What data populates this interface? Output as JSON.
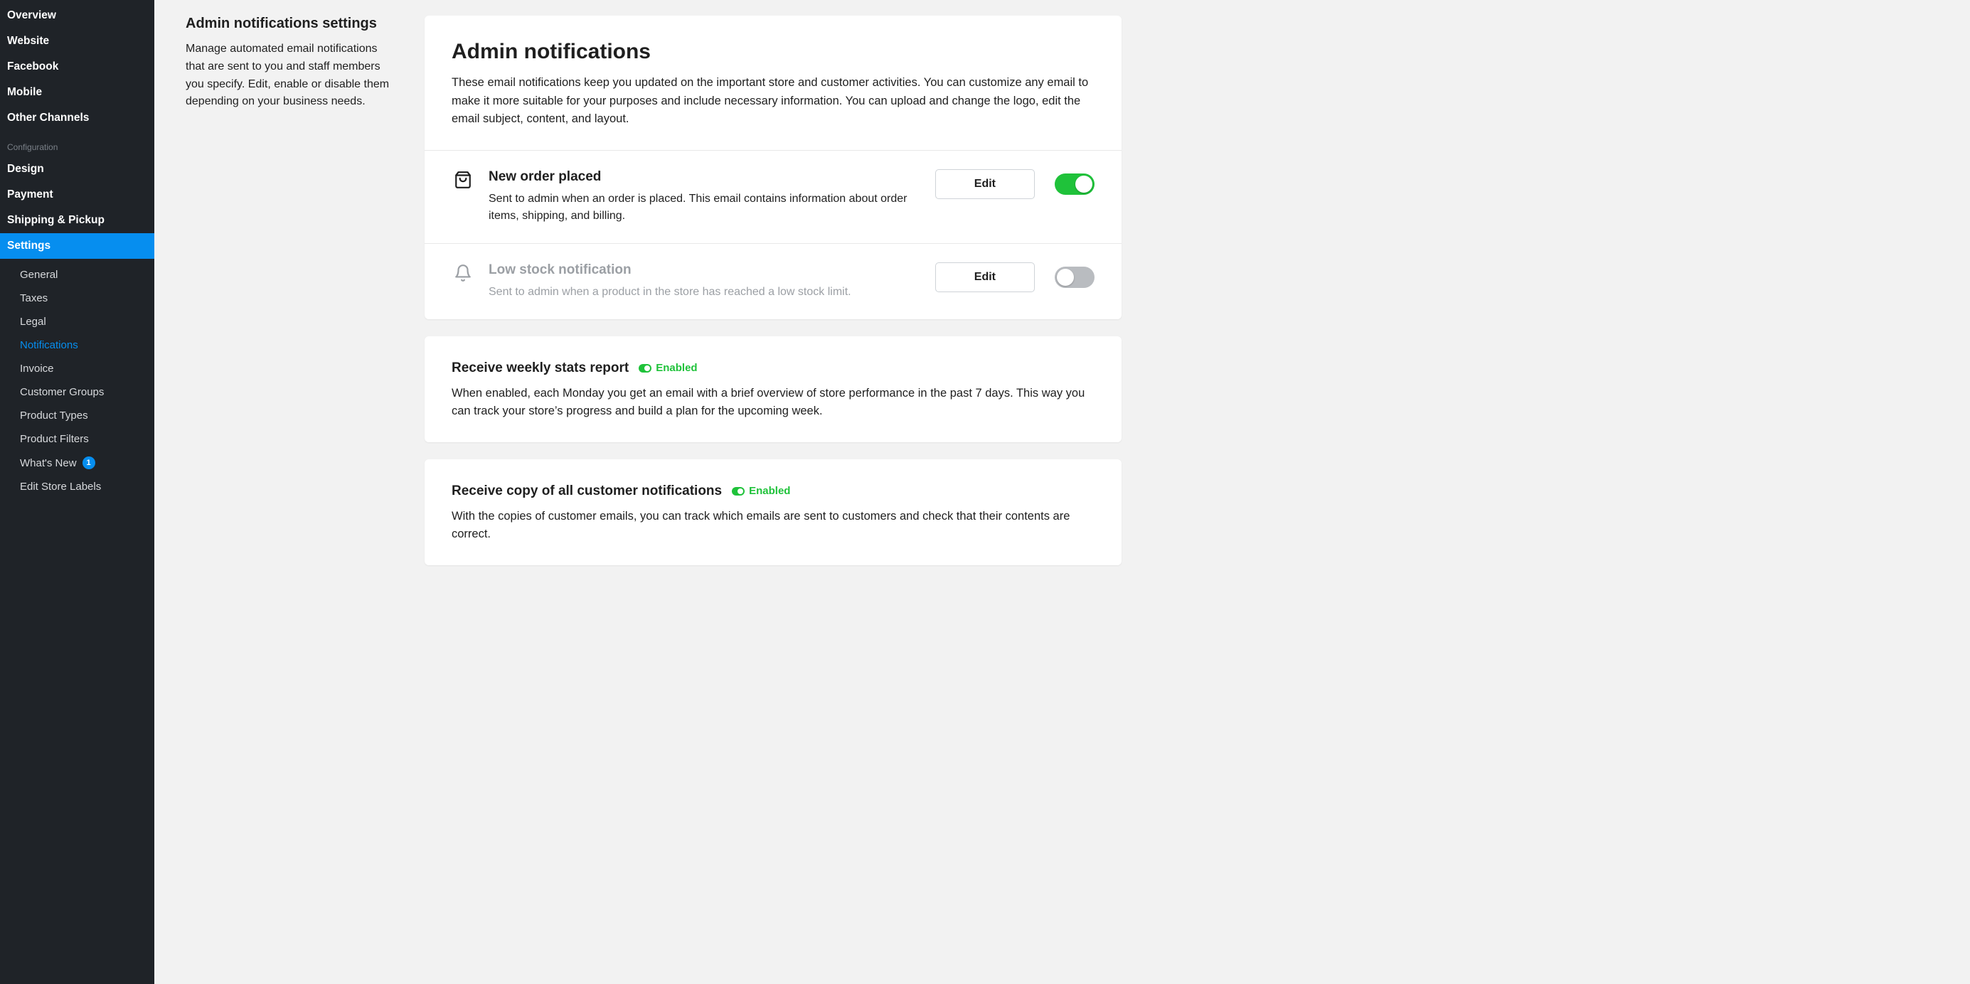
{
  "sidebar": {
    "primary": [
      {
        "label": "Overview"
      },
      {
        "label": "Website"
      },
      {
        "label": "Facebook"
      },
      {
        "label": "Mobile"
      },
      {
        "label": "Other Channels"
      }
    ],
    "config_label": "Configuration",
    "config": [
      {
        "label": "Design"
      },
      {
        "label": "Payment"
      },
      {
        "label": "Shipping & Pickup"
      },
      {
        "label": "Settings",
        "active": true
      }
    ],
    "sub": [
      {
        "label": "General"
      },
      {
        "label": "Taxes"
      },
      {
        "label": "Legal"
      },
      {
        "label": "Notifications",
        "active": true
      },
      {
        "label": "Invoice"
      },
      {
        "label": "Customer Groups"
      },
      {
        "label": "Product Types"
      },
      {
        "label": "Product Filters"
      },
      {
        "label": "What's New",
        "badge": "1"
      },
      {
        "label": "Edit Store Labels"
      }
    ]
  },
  "intro": {
    "title": "Admin notifications settings",
    "desc": "Manage automated email notifications that are sent to you and staff members you specify. Edit, enable or disable them depending on your business needs."
  },
  "admin_card": {
    "heading": "Admin notifications",
    "lead": "These email notifications keep you updated on the important store and customer activities. You can customize any email to make it more suitable for your purposes and include necessary information. You can upload and change the logo, edit the email subject, content, and layout.",
    "rows": [
      {
        "title": "New order placed",
        "desc": "Sent to admin when an order is placed. This email contains information about order items, shipping, and billing.",
        "edit": "Edit",
        "enabled": true
      },
      {
        "title": "Low stock notification",
        "desc": "Sent to admin when a product in the store has reached a low stock limit.",
        "edit": "Edit",
        "enabled": false
      }
    ]
  },
  "weekly": {
    "title": "Receive weekly stats report",
    "status": "Enabled",
    "desc": "When enabled, each Monday you get an email with a brief overview of store performance in the past 7 days. This way you can track your store’s progress and build a plan for the upcoming week."
  },
  "copy": {
    "title": "Receive copy of all customer notifications",
    "status": "Enabled",
    "desc": "With the copies of customer emails, you can track which emails are sent to customers and check that their contents are correct."
  }
}
